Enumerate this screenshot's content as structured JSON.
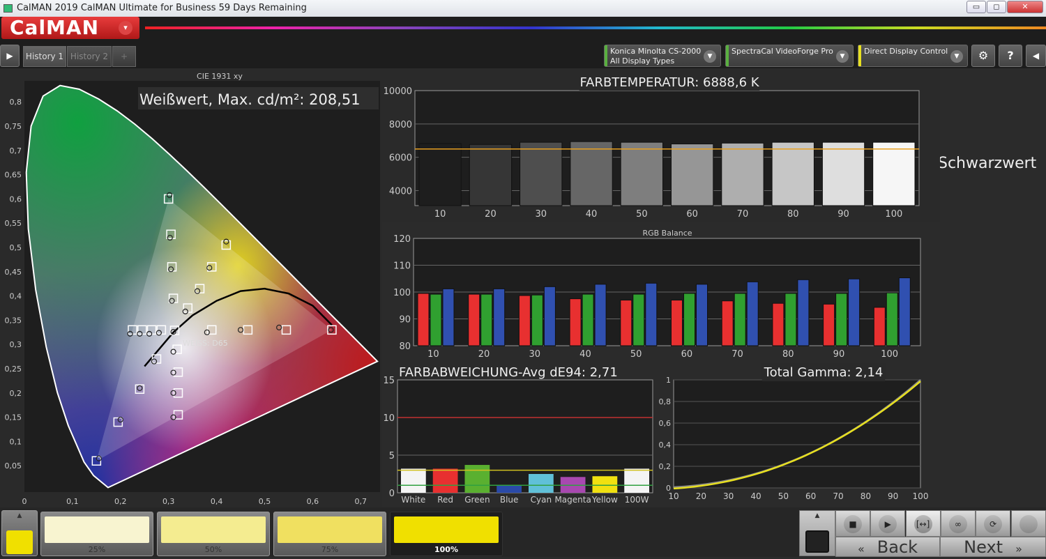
{
  "window": {
    "title": "CalMAN 2019 CalMAN Ultimate for Business 59 Days Remaining",
    "minimize": "▭",
    "restore": "◻",
    "close": "✕"
  },
  "header": {
    "logo": "CalMAN",
    "logo_dropdown": "▾"
  },
  "tabs": {
    "nav_icon": "▶",
    "items": [
      {
        "label": "History 1",
        "active": true
      },
      {
        "label": "History 2",
        "active": false
      }
    ],
    "add": "+"
  },
  "devices": [
    {
      "line1": "Konica Minolta CS-2000",
      "line2": "All Display Types",
      "color": "#5ab040"
    },
    {
      "line1": "SpectraCal VideoForge Pro",
      "line2": "",
      "color": "#5ab040"
    },
    {
      "line1": "Direct Display Control",
      "line2": "",
      "color": "#e8e020"
    }
  ],
  "toolbar": {
    "settings": "⚙",
    "help": "?",
    "back_panel": "◀"
  },
  "schwarzwert": "Schwarzwert",
  "cie": {
    "title": "CIE 1931 xy",
    "white_label": "Weißwert, Max. cd/m²: 208,51",
    "white_point_label": "WEISS: D65"
  },
  "chart_data": [
    {
      "type": "scatter",
      "title": "CIE 1931 xy",
      "x_ticks": [
        "0",
        "0,1",
        "0,2",
        "0,3",
        "0,4",
        "0,5",
        "0,6",
        "0,7"
      ],
      "y_ticks": [
        "0,05",
        "0,1",
        "0,15",
        "0,2",
        "0,25",
        "0,3",
        "0,35",
        "0,4",
        "0,45",
        "0,5",
        "0,55",
        "0,6",
        "0,65",
        "0,7",
        "0,75",
        "0,8"
      ],
      "xlim": [
        0,
        0.74
      ],
      "ylim": [
        0,
        0.85
      ],
      "gamut_triangle": [
        [
          0.64,
          0.33
        ],
        [
          0.3,
          0.6
        ],
        [
          0.15,
          0.06
        ]
      ],
      "targets": [
        [
          0.64,
          0.33
        ],
        [
          0.545,
          0.33
        ],
        [
          0.465,
          0.33
        ],
        [
          0.39,
          0.33
        ],
        [
          0.3,
          0.6
        ],
        [
          0.305,
          0.527
        ],
        [
          0.307,
          0.46
        ],
        [
          0.31,
          0.395
        ],
        [
          0.15,
          0.06
        ],
        [
          0.195,
          0.14
        ],
        [
          0.24,
          0.208
        ],
        [
          0.275,
          0.27
        ],
        [
          0.225,
          0.33
        ],
        [
          0.245,
          0.33
        ],
        [
          0.265,
          0.33
        ],
        [
          0.285,
          0.33
        ],
        [
          0.42,
          0.505
        ],
        [
          0.39,
          0.46
        ],
        [
          0.365,
          0.415
        ],
        [
          0.34,
          0.375
        ],
        [
          0.32,
          0.155
        ],
        [
          0.32,
          0.2
        ],
        [
          0.32,
          0.243
        ],
        [
          0.318,
          0.29
        ],
        [
          0.3127,
          0.329
        ]
      ],
      "measured": [
        [
          0.638,
          0.33
        ],
        [
          0.53,
          0.335
        ],
        [
          0.45,
          0.33
        ],
        [
          0.38,
          0.325
        ],
        [
          0.302,
          0.608
        ],
        [
          0.303,
          0.52
        ],
        [
          0.305,
          0.455
        ],
        [
          0.307,
          0.39
        ],
        [
          0.155,
          0.065
        ],
        [
          0.2,
          0.145
        ],
        [
          0.24,
          0.21
        ],
        [
          0.27,
          0.265
        ],
        [
          0.22,
          0.322
        ],
        [
          0.24,
          0.322
        ],
        [
          0.26,
          0.322
        ],
        [
          0.28,
          0.324
        ],
        [
          0.42,
          0.512
        ],
        [
          0.385,
          0.458
        ],
        [
          0.36,
          0.41
        ],
        [
          0.335,
          0.368
        ],
        [
          0.31,
          0.15
        ],
        [
          0.31,
          0.2
        ],
        [
          0.31,
          0.242
        ],
        [
          0.31,
          0.285
        ],
        [
          0.31,
          0.326
        ]
      ],
      "planckian_locus": [
        [
          0.25,
          0.255
        ],
        [
          0.28,
          0.29
        ],
        [
          0.31,
          0.325
        ],
        [
          0.35,
          0.36
        ],
        [
          0.4,
          0.39
        ],
        [
          0.45,
          0.41
        ],
        [
          0.5,
          0.415
        ],
        [
          0.55,
          0.405
        ],
        [
          0.6,
          0.38
        ],
        [
          0.64,
          0.34
        ]
      ]
    },
    {
      "type": "bar",
      "title": "FARBTEMPERATUR: 6888,6 K",
      "categories": [
        "10",
        "20",
        "30",
        "40",
        "50",
        "60",
        "70",
        "80",
        "90",
        "100"
      ],
      "values": [
        6820,
        6770,
        6900,
        6940,
        6900,
        6800,
        6850,
        6900,
        6900,
        6900
      ],
      "target": 6500,
      "y_ticks": [
        "4000",
        "6000",
        "8000",
        "10000"
      ],
      "ylim": [
        3100,
        10000
      ],
      "target_color": "#e8a020"
    },
    {
      "type": "bar",
      "title": "RGB Balance",
      "categories": [
        "10",
        "20",
        "30",
        "40",
        "50",
        "60",
        "70",
        "80",
        "90",
        "100"
      ],
      "series": [
        {
          "values": [
            99.5,
            99.2,
            98.7,
            97.5,
            97.0,
            97.0,
            96.7,
            95.8,
            95.5,
            94.3
          ],
          "color": "#e83030"
        },
        {
          "values": [
            99.2,
            99.2,
            98.9,
            99.2,
            99.2,
            99.5,
            99.5,
            99.5,
            99.5,
            99.7
          ],
          "color": "#30a030"
        },
        {
          "values": [
            101.2,
            101.2,
            102.0,
            102.9,
            103.3,
            102.9,
            103.8,
            104.6,
            104.9,
            105.3
          ],
          "color": "#3050b0"
        }
      ],
      "y_ticks": [
        "80",
        "90",
        "100",
        "110",
        "120"
      ],
      "ylim": [
        80,
        120
      ]
    },
    {
      "type": "bar",
      "title": "FARBABWEICHUNG-Avg dE94: 2,71",
      "categories": [
        "White",
        "Red",
        "Green",
        "Blue",
        "Cyan",
        "Magenta",
        "Yellow",
        "100W"
      ],
      "values": [
        3.2,
        3.2,
        3.7,
        1.0,
        2.5,
        2.1,
        2.2,
        3.2
      ],
      "colors": [
        "#f4f4f4",
        "#e83030",
        "#5ab030",
        "#2a4aa8",
        "#60c0d8",
        "#a848b0",
        "#f0e010",
        "#f4f4f4"
      ],
      "thresholds": [
        {
          "value": 10,
          "color": "#c03030"
        },
        {
          "value": 3,
          "color": "#d0c020"
        },
        {
          "value": 1,
          "color": "#30a040"
        }
      ],
      "y_ticks": [
        "0",
        "5",
        "10",
        "15"
      ],
      "ylim": [
        0,
        15
      ]
    },
    {
      "type": "line",
      "title": "Total Gamma: 2,14",
      "x_ticks": [
        "10",
        "20",
        "30",
        "40",
        "50",
        "60",
        "70",
        "80",
        "90",
        "100"
      ],
      "y_ticks": [
        "0",
        "0,2",
        "0,4",
        "0,6",
        "0,8",
        "1"
      ],
      "xlim": [
        10,
        100
      ],
      "ylim": [
        0,
        1
      ],
      "series": [
        {
          "gamma": 2.2,
          "color": "#888888"
        },
        {
          "gamma": 2.14,
          "color": "#e8e020"
        }
      ]
    }
  ],
  "bottom": {
    "swatches": [
      {
        "label": "25%",
        "color": "#f8f4d0"
      },
      {
        "label": "50%",
        "color": "#f4ec90"
      },
      {
        "label": "75%",
        "color": "#f0e060"
      },
      {
        "label": "100%",
        "color": "#f0e000"
      }
    ],
    "current_color": "#f0e000",
    "controls": [
      "■",
      "▶",
      "[↔]",
      "∞",
      "⟳",
      ""
    ],
    "back": "Back",
    "next": "Next",
    "back_icon": "«",
    "next_icon": "»",
    "up_icon": "▲"
  }
}
